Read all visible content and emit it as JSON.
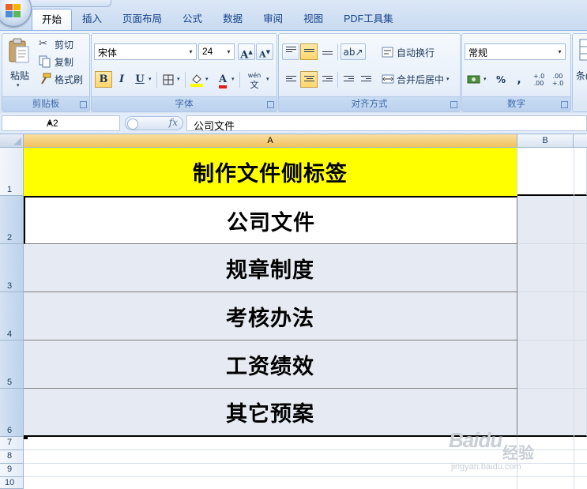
{
  "tabs": [
    "开始",
    "插入",
    "页面布局",
    "公式",
    "数据",
    "审阅",
    "视图",
    "PDF工具集"
  ],
  "active_tab": "开始",
  "ribbon": {
    "clipboard": {
      "label": "剪贴板",
      "paste": "粘贴",
      "cut": "剪切",
      "copy": "复制",
      "format_painter": "格式刷"
    },
    "font": {
      "label": "字体",
      "font_name": "宋体",
      "font_size": "24",
      "bold": "B",
      "italic": "I",
      "underline": "U",
      "phonetic": "wén"
    },
    "alignment": {
      "label": "对齐方式",
      "wrap_text": "自动换行",
      "merge_center": "合并后居中"
    },
    "number": {
      "label": "数字",
      "format": "常规",
      "percent": "%",
      "comma": ",",
      "inc_decimal": "+.0 .00",
      "dec_decimal": ".00 +.0"
    },
    "styles": {
      "label_fragment": "条("
    }
  },
  "formula_bar": {
    "name_box": "A2",
    "fx": "fx",
    "content": "公司文件"
  },
  "grid": {
    "columns": [
      "A",
      "B"
    ],
    "rows": [
      "1",
      "2",
      "3",
      "4",
      "5",
      "6",
      "7",
      "8",
      "9",
      "10"
    ],
    "cells": [
      "制作文件侧标签",
      "公司文件",
      "规章制度",
      "考核办法",
      "工资绩效",
      "其它预案"
    ]
  },
  "colors": {
    "title_fill": "#ffff00",
    "selection": "#e6ebf3",
    "header_selected": "#f1c15f",
    "ribbon": "#dbe7f6"
  },
  "watermark": {
    "brand": "Baidu",
    "suffix": "经验",
    "url": "jingyan.baidu.com"
  }
}
